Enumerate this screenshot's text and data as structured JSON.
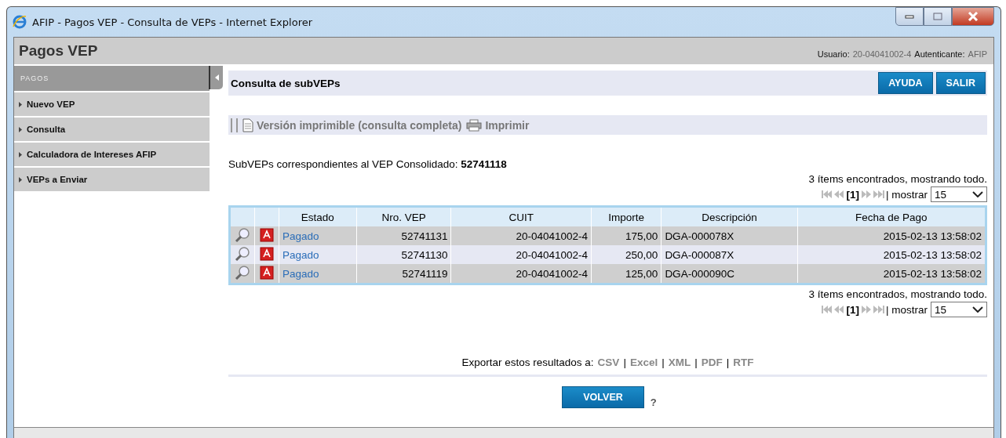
{
  "window": {
    "title": "AFIP - Pagos VEP - Consulta de VEPs - Internet Explorer"
  },
  "header": {
    "title": "Pagos VEP",
    "user_label": "Usuario:",
    "user": "20-04041002-4",
    "auth_label": "Autenticante:",
    "auth": "AFIP"
  },
  "sidebar": {
    "title": "PAGOS",
    "items": [
      {
        "label": "Nuevo VEP"
      },
      {
        "label": "Consulta"
      },
      {
        "label": "Calculadora de Intereses AFIP"
      },
      {
        "label": "VEPs a Enviar"
      }
    ]
  },
  "page": {
    "title": "Consulta de subVEPs",
    "buttons": [
      "AYUDA",
      "SALIR"
    ],
    "toolbar": [
      "Versión imprimible (consulta completa)",
      "Imprimir"
    ],
    "intro": "SubVEPs correspondientes al VEP Consolidado: **52741118**",
    "summary_top": "3 ítems encontrados, mostrando todo.",
    "pager_top": {
      "page": "[1]",
      "label": "| mostrar",
      "size": "15"
    },
    "table": {
      "columns": [
        "Estado",
        "Nro. VEP",
        "CUIT",
        "Importe",
        "Descripción",
        "Fecha de Pago"
      ],
      "rows": [
        {
          "estado": "Pagado",
          "nro": "52741131",
          "cuit": "20-04041002-4",
          "importe": "175,00",
          "descripcion": "DGA-000078X",
          "fecha": "2015-02-13 13:58:02"
        },
        {
          "estado": "Pagado",
          "nro": "52741130",
          "cuit": "20-04041002-4",
          "importe": "250,00",
          "descripcion": "DGA-000087X",
          "fecha": "2015-02-13 13:58:02"
        },
        {
          "estado": "Pagado",
          "nro": "52741119",
          "cuit": "20-04041002-4",
          "importe": "125,00",
          "descripcion": "DGA-000090C",
          "fecha": "2015-02-13 13:58:02"
        }
      ]
    },
    "summary_bottom": "3 ítems encontrados, mostrando todo.",
    "pager_bottom": {
      "page": "[1]",
      "label": "| mostrar",
      "size": "15"
    },
    "export": {
      "label": "Exportar estos resultados a:",
      "links": [
        {
          "label": "CSV",
          "separator": "|"
        },
        {
          "label": "Excel",
          "separator": "|"
        },
        {
          "label": "XML",
          "separator": "|"
        },
        {
          "label": "PDF",
          "separator": "|"
        },
        {
          "label": "RTF"
        }
      ]
    },
    "back_button": "VOLVER",
    "help": "?"
  }
}
